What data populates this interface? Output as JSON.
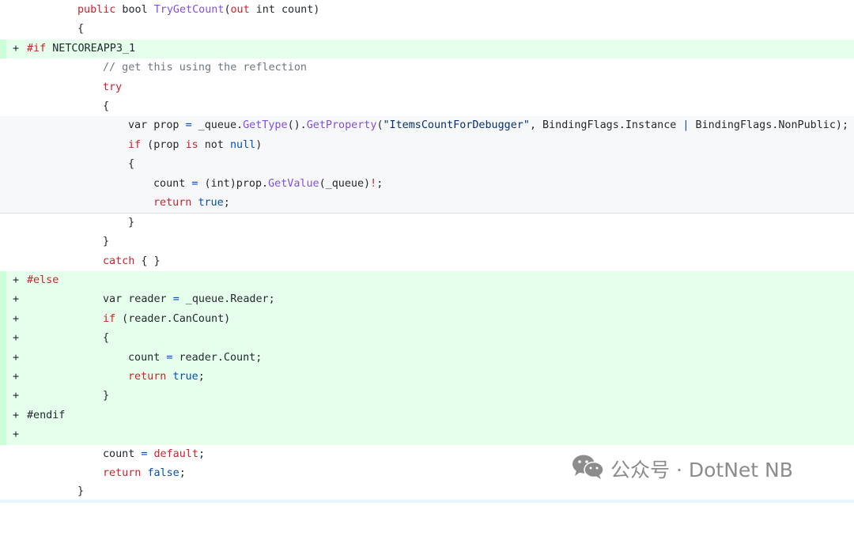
{
  "lines": [
    {
      "marker": "",
      "indent": 8,
      "tokens": [
        [
          "kw",
          "public"
        ],
        [
          "",
          "bool "
        ],
        [
          "fn",
          "TryGetCount"
        ],
        [
          "",
          "("
        ],
        [
          "kw",
          "out"
        ],
        [
          "",
          ""
        ],
        " int count)"
      ]
    },
    {
      "marker": "",
      "indent": 8,
      "tokens": [
        [
          "",
          "{"
        ]
      ]
    }
  ],
  "code": {
    "l01": "public",
    "l01b": " bool ",
    "l01c": "TryGetCount",
    "l01d": "(",
    "l01e": "out",
    "l01f": " int count)",
    "l02": "{",
    "l03a": "#if",
    "l03b": " NETCOREAPP3_1",
    "l04": "// get this using the reflection",
    "l05": "try",
    "l06": "{",
    "l07a": "var prop ",
    "l07b": "=",
    "l07c": " _queue.",
    "l07d": "GetType",
    "l07e": "().",
    "l07f": "GetProperty",
    "l07g": "(",
    "l07h": "\"ItemsCountForDebugger\"",
    "l07i": ", BindingFlags.Instance ",
    "l07j": "|",
    "l07k": " BindingFlags.NonPublic);",
    "l08a": "if",
    "l08b": " (prop ",
    "l08c": "is",
    "l08d": " not ",
    "l08e": "null",
    "l08f": ")",
    "l09": "{",
    "l10a": "count ",
    "l10b": "=",
    "l10c": " (int)prop.",
    "l10d": "GetValue",
    "l10e": "(_queue)",
    "l10f": "!",
    "l10g": ";",
    "l11a": "return",
    "l11b": " ",
    "l11c": "true",
    "l11d": ";",
    "l12": "}",
    "l13": "}",
    "l14a": "catch",
    "l14b": " { }",
    "l15": "#else",
    "l16a": "var reader ",
    "l16b": "=",
    "l16c": " _queue.Reader;",
    "l17a": "if",
    "l17b": " (reader.CanCount)",
    "l18": "{",
    "l19a": "count ",
    "l19b": "=",
    "l19c": " reader.Count;",
    "l20a": "return",
    "l20b": " ",
    "l20c": "true",
    "l20d": ";",
    "l21": "}",
    "l22": "#endif",
    "l24a": "count ",
    "l24b": "=",
    "l24c": " ",
    "l24d": "default",
    "l24e": ";",
    "l25a": "return",
    "l25b": " ",
    "l25c": "false",
    "l25d": ";",
    "l26": "}"
  },
  "marker": "+",
  "watermark": {
    "text": "公众号 · DotNet NB",
    "icon": "wechat-icon",
    "color": "#8c8c8c"
  },
  "colors": {
    "added_bg": "#e6ffec",
    "added_gutter": "#ccffd8",
    "highlight_bg": "#f6f8fa",
    "keyword": "#cf222e",
    "function": "#8250df",
    "string": "#0a3069",
    "literal": "#0550ae",
    "comment": "#6e7781"
  }
}
